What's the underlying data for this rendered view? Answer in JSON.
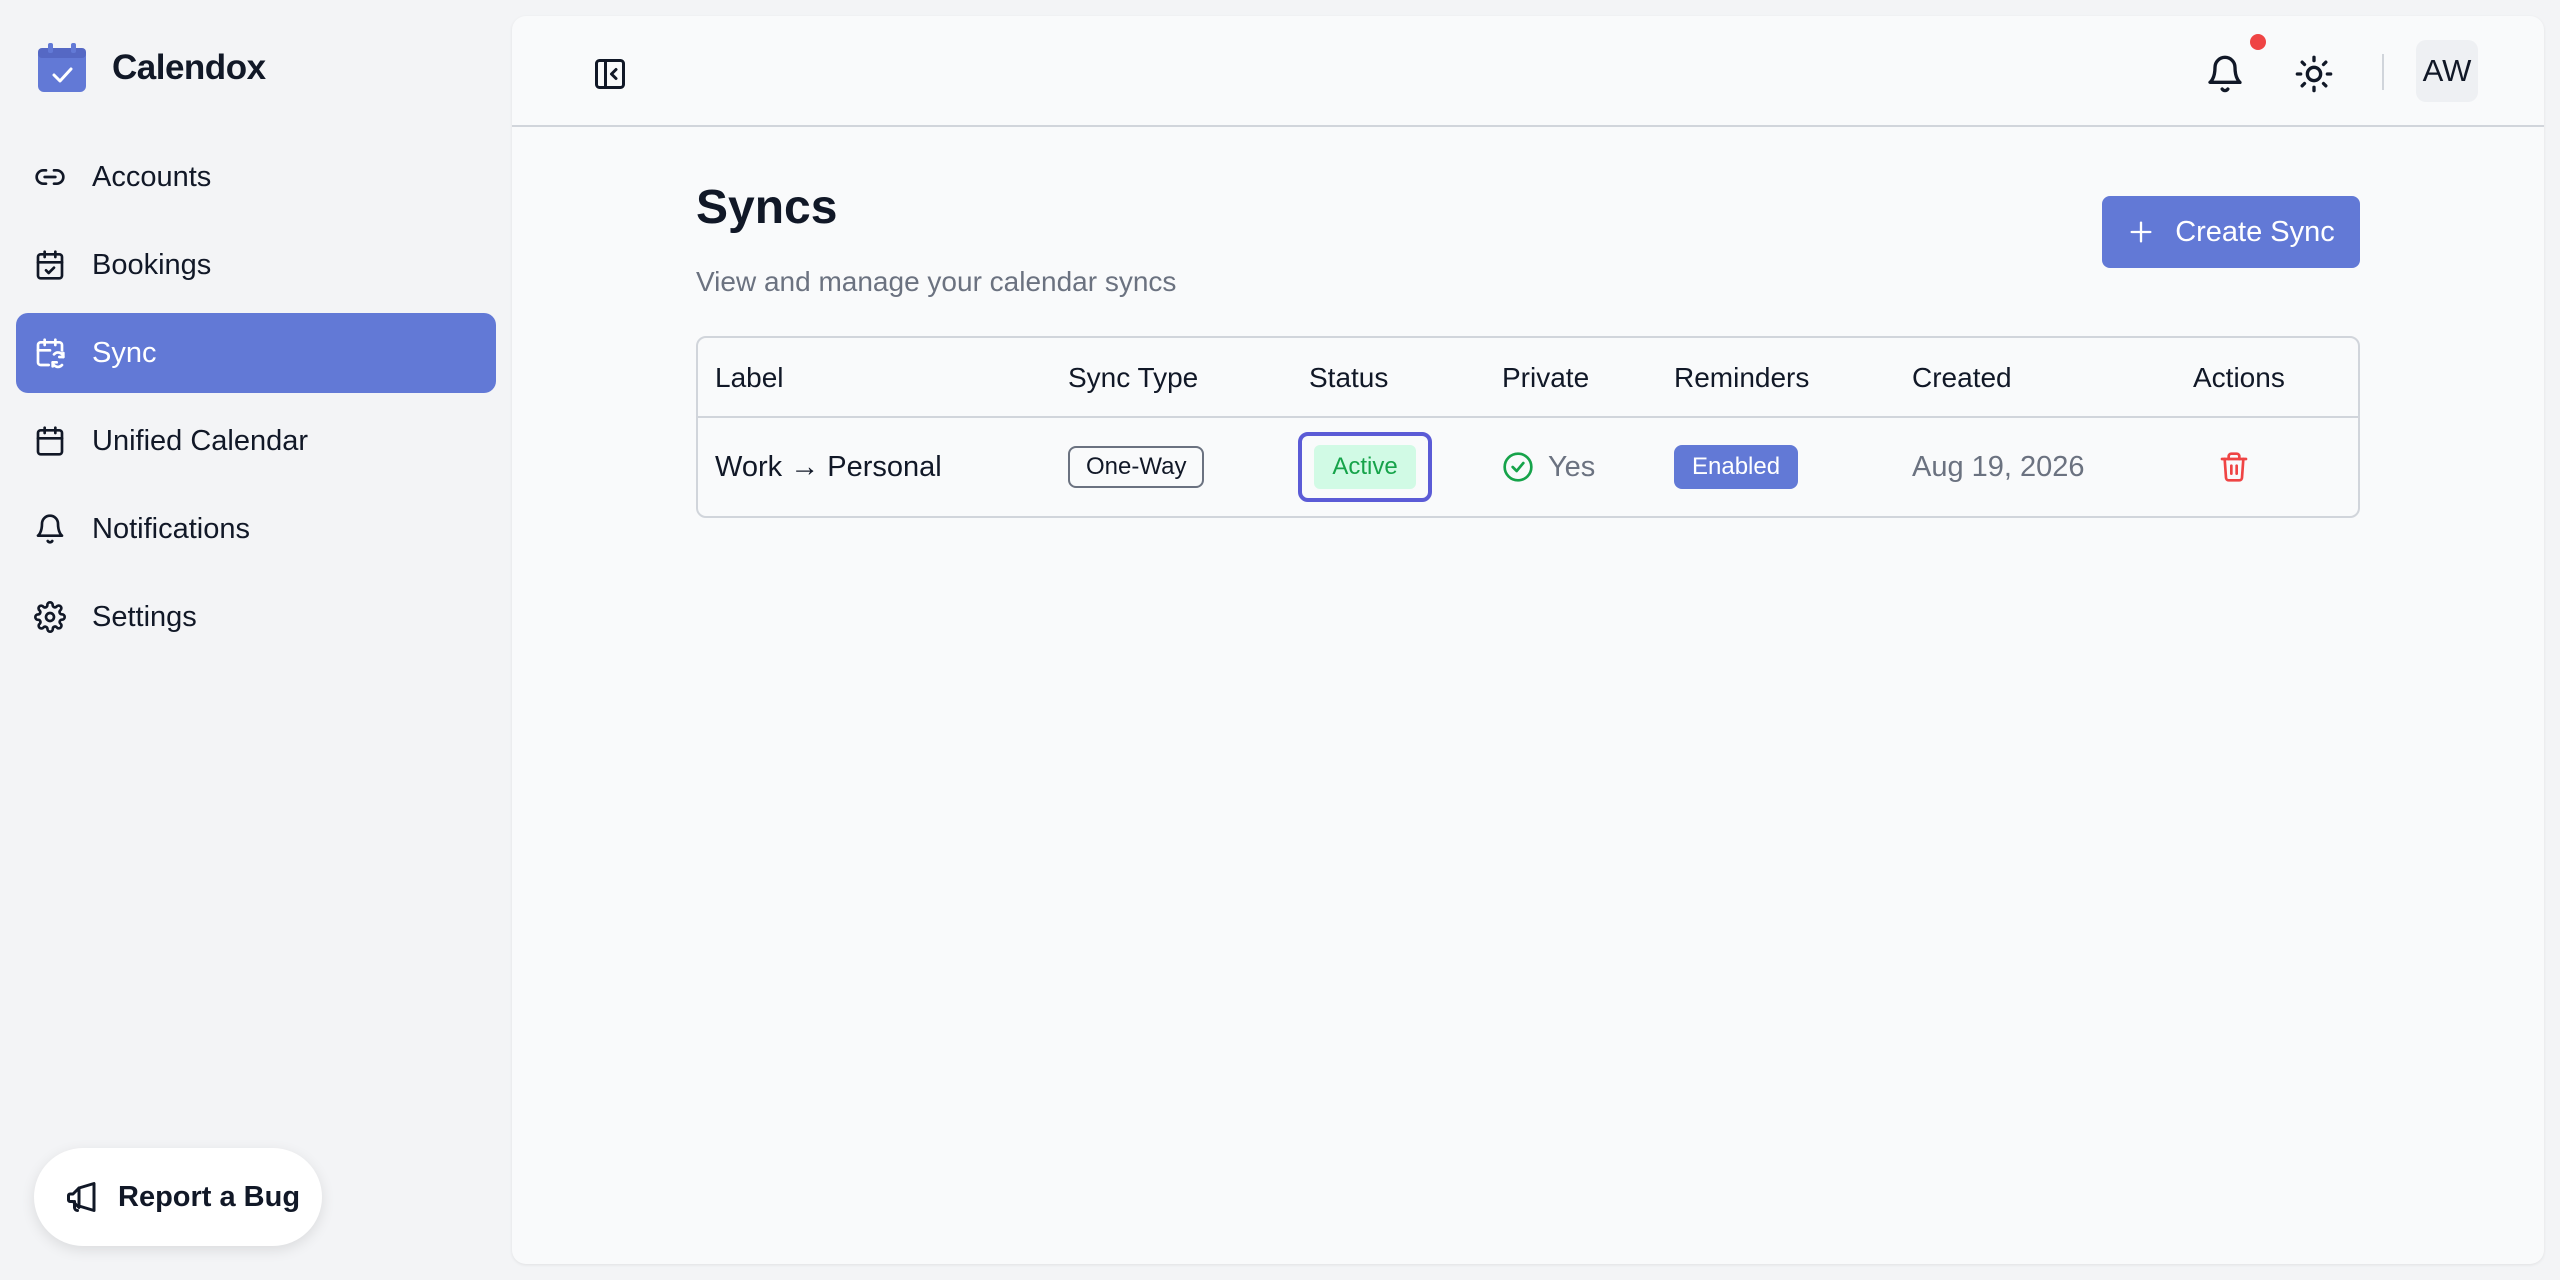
{
  "app": {
    "name": "Calendox"
  },
  "colors": {
    "accent": "#6279d6",
    "danger": "#ef4444",
    "success": "#16a34a",
    "focus_ring": "#5b5bd6"
  },
  "sidebar": {
    "items": [
      {
        "label": "Accounts",
        "icon": "link-icon",
        "active": false
      },
      {
        "label": "Bookings",
        "icon": "calendar-check-icon",
        "active": false
      },
      {
        "label": "Sync",
        "icon": "calendar-sync-icon",
        "active": true
      },
      {
        "label": "Unified Calendar",
        "icon": "calendar-icon",
        "active": false
      },
      {
        "label": "Notifications",
        "icon": "bell-icon",
        "active": false
      },
      {
        "label": "Settings",
        "icon": "gear-icon",
        "active": false
      }
    ],
    "report_bug_label": "Report a Bug"
  },
  "topbar": {
    "avatar_initials": "AW",
    "has_unread_notifications": true
  },
  "page": {
    "title": "Syncs",
    "subtitle": "View and manage your calendar syncs",
    "create_label": "Create Sync"
  },
  "table": {
    "headers": [
      "Label",
      "Sync Type",
      "Status",
      "Private",
      "Reminders",
      "Created",
      "Actions"
    ],
    "rows": [
      {
        "label": "Work → Personal",
        "sync_type": "One-Way",
        "status": "Active",
        "private": "Yes",
        "reminders": "Enabled",
        "created": "Aug 19, 2026"
      }
    ]
  }
}
